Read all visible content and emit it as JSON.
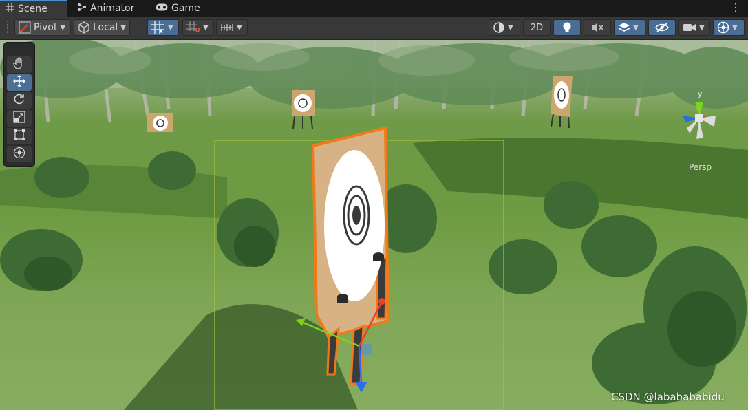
{
  "tabs": [
    {
      "label": "Scene",
      "icon": "grid-icon",
      "active": true
    },
    {
      "label": "Animator",
      "icon": "animator-icon",
      "active": false
    },
    {
      "label": "Game",
      "icon": "gamepad-icon",
      "active": false
    }
  ],
  "toolbar": {
    "pivot_label": "Pivot",
    "local_label": "Local",
    "mode_2d_label": "2D"
  },
  "tools": [
    "hand-tool",
    "move-tool",
    "rotate-tool",
    "scale-tool",
    "rect-tool",
    "transform-tool"
  ],
  "active_tool": "move-tool",
  "gizmo": {
    "axis_label": "y",
    "projection_label": "Persp"
  },
  "watermark": "CSDN @lababababidu",
  "colors": {
    "accent_blue": "#4d8fd6",
    "selection_orange": "#f07a1a",
    "axis_x": "#e8402a",
    "axis_y": "#7ed321",
    "axis_z": "#2a6fe8"
  }
}
